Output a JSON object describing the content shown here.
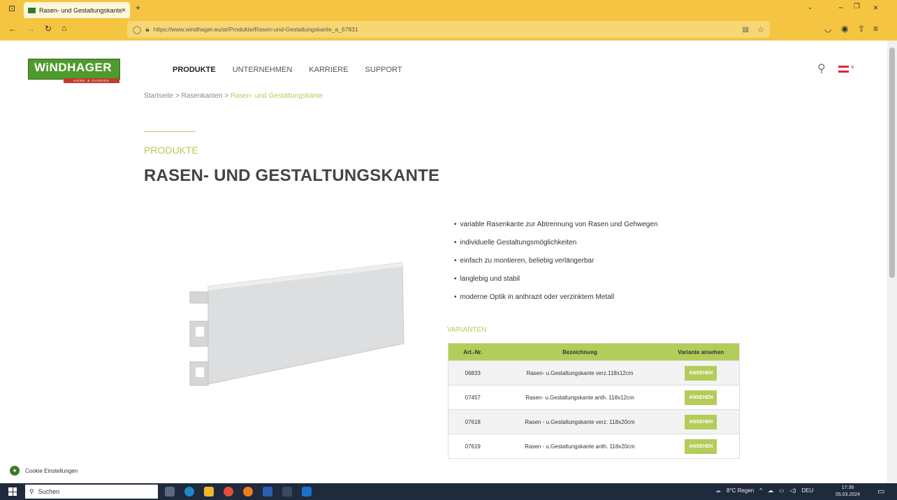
{
  "browser": {
    "tab_title": "Rasen- und Gestaltungskante | ",
    "url": "https://www.windhager.eu/at/Produkte/Rasen-und-Gestaltungskante_a_67831"
  },
  "logo": {
    "text": "WiNDHAGER",
    "tagline": "HOME & GARDEN"
  },
  "nav": {
    "produkte": "PRODUKTE",
    "unternehmen": "UNTERNEHMEN",
    "karriere": "KARRIERE",
    "support": "SUPPORT"
  },
  "breadcrumb": {
    "home": "Startseite",
    "sep1": " > ",
    "category": "Rasenkanten",
    "sep2": " > ",
    "current": "Rasen- und Gestaltungskante"
  },
  "product": {
    "kicker": "PRODUKTE",
    "title": "RASEN- UND GESTALTUNGSKANTE",
    "features": [
      "variable Rasenkante zur Abtrennung von Rasen und Gehwegen",
      "individuelle Gestaltungsmöglichkeiten",
      "einfach zu montieren, beliebig verlängerbar",
      "langlebig und stabil",
      "moderne Optik in anthrazit oder verzinktem Metall"
    ]
  },
  "variants": {
    "heading": "VARIANTEN",
    "columns": [
      "Art.-Nr.",
      "Bezeichnung",
      "Variante ansehen"
    ],
    "button_label": "ANSEHEN",
    "rows": [
      {
        "art": "06833",
        "name": "Rasen- u.Gestaltungskante verz.118x12cm"
      },
      {
        "art": "07457",
        "name": "Rasen- u.Gestaltungskante anth. 118x12cm"
      },
      {
        "art": "07618",
        "name": "Rasen - u.Gestaltungskante verz. 118x20cm"
      },
      {
        "art": "07619",
        "name": "Rasen - u.Gestaltungskante anth. 118x20cm"
      }
    ]
  },
  "cookie": {
    "label": "Cookie Einstellungen"
  },
  "taskbar": {
    "search_placeholder": "Suchen",
    "weather": "8°C Regen",
    "lang": "DEU",
    "time": "17:36",
    "date": "05.03.2024"
  },
  "colors": {
    "accent": "#b3cc5a",
    "browser_chrome": "#f5c542",
    "brand_green": "#4f9a2d"
  }
}
